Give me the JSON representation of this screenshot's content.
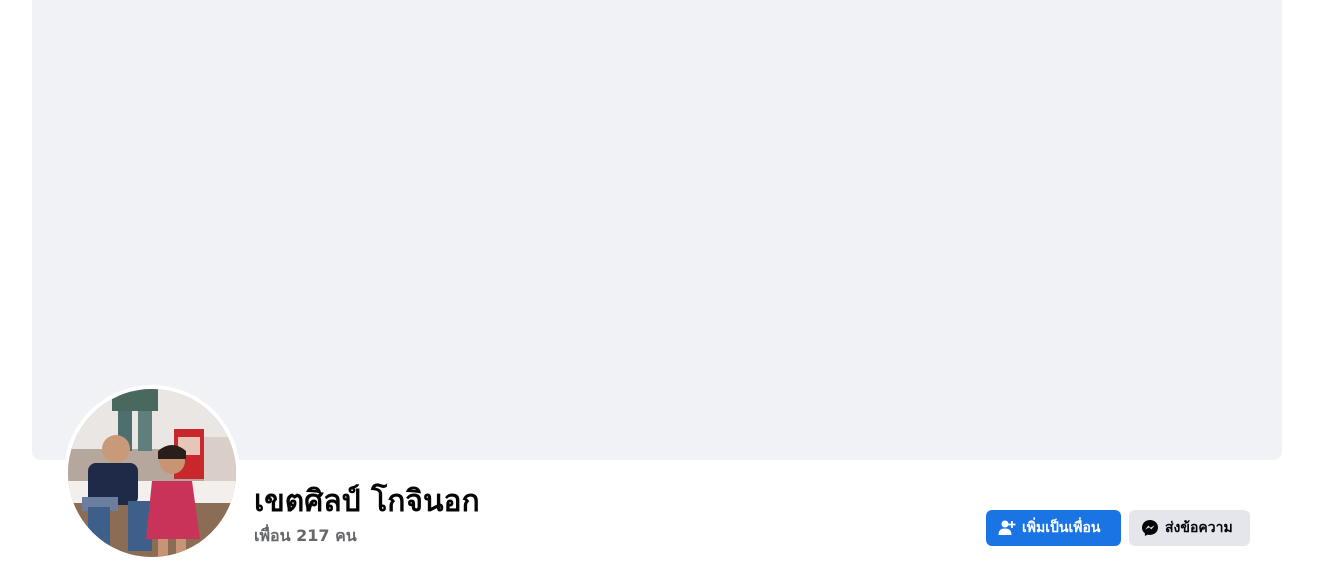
{
  "profile": {
    "name": "เขตศิลป์ โกจินอก",
    "friends_text": "เพื่อน 217 คน"
  },
  "actions": {
    "add_friend_label": "เพิ่มเป็นเพื่อน",
    "message_label": "ส่งข้อความ"
  },
  "icons": {
    "add_friend": "person-add-icon",
    "message": "messenger-icon"
  },
  "colors": {
    "cover_bg": "#f0f2f5",
    "primary_button": "#1b74e4",
    "secondary_button": "#e4e6eb",
    "muted_text": "#65676b"
  }
}
